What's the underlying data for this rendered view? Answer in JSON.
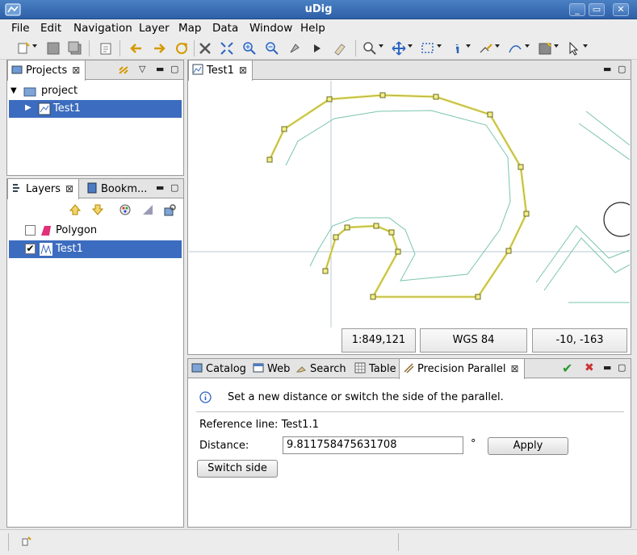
{
  "window": {
    "title": "uDig"
  },
  "menu": [
    "File",
    "Edit",
    "Navigation",
    "Layer",
    "Map",
    "Data",
    "Window",
    "Help"
  ],
  "projects_view": {
    "tab_label": "Projects",
    "tree": [
      {
        "label": "project"
      },
      {
        "label": "Test1"
      }
    ]
  },
  "layers_view": {
    "tabs": [
      "Layers",
      "Bookm..."
    ],
    "items": [
      {
        "label": "Polygon",
        "checked": false
      },
      {
        "label": "Test1",
        "checked": true
      }
    ]
  },
  "map_view": {
    "tab_label": "Test1",
    "scale": "1:849,121",
    "crs": "WGS 84",
    "coords": "-10, -163"
  },
  "bottom_views": {
    "tabs": [
      "Catalog",
      "Web",
      "Search",
      "Table",
      "Precision Parallel"
    ],
    "info_text": "Set a new distance or switch the side of the parallel.",
    "reference_line": "Reference line: Test1.1",
    "distance_label": "Distance:",
    "distance_value": "9.811758475631708",
    "unit": "°",
    "apply_label": "Apply",
    "switch_label": "Switch side"
  },
  "colors": {
    "selection": "#3c6cbf",
    "line_feature": "#e8e47a",
    "parallel_line": "#7ac4b0"
  }
}
